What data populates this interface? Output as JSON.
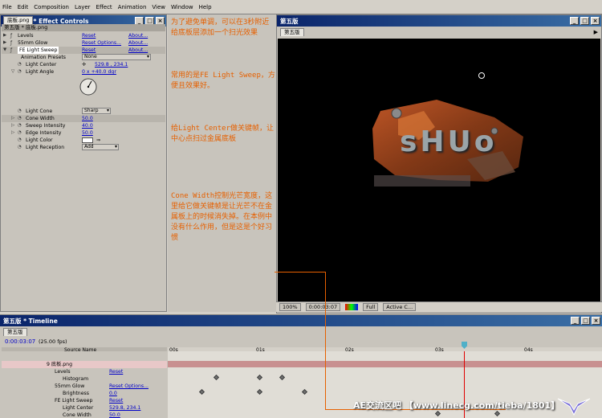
{
  "menu": [
    "File",
    "Edit",
    "Composition",
    "Layer",
    "Effect",
    "Animation",
    "View",
    "Window",
    "Help"
  ],
  "effect_controls": {
    "title": "底板.png * Effect Controls",
    "tab": "底板.png",
    "layer_path": "第五版 * 底板.png",
    "rows": [
      {
        "name": "Levels",
        "value": "Reset",
        "about": "About..."
      },
      {
        "name": "55mm Glow",
        "value": "Reset Options...",
        "about": "About..."
      },
      {
        "name": "FE Light Sweep",
        "value": "Reset",
        "about": "About..."
      },
      {
        "name": "Animation Presets",
        "value": "None"
      },
      {
        "name": "Light Center",
        "value": "529.8 , 234.1"
      },
      {
        "name": "Light Angle",
        "value": "0 x +40.0 dgr"
      },
      {
        "name": "Light Cone",
        "value": "Sharp"
      },
      {
        "name": "Cone Width",
        "value": "50.0"
      },
      {
        "name": "Sweep Intensity",
        "value": "40.0"
      },
      {
        "name": "Edge Intensity",
        "value": "50.0"
      },
      {
        "name": "Light Color",
        "value": ""
      },
      {
        "name": "Light Reception",
        "value": "Add"
      }
    ]
  },
  "notes": [
    "为了避免单调，可以在3秒附近给底板层添加一个扫光效果",
    "常用的是FE Light Sweep，方便且效果好。",
    "给Light Center做关键帧，让中心点扫过金属底板",
    "Cone Width控制光芒宽度，这里给它做关键帧是让光芒不在金属板上的时候消失掉。在本例中没有什么作用，但是这是个好习惯"
  ],
  "composition": {
    "title": "第五版",
    "tab": "第五版",
    "logo_text": "sHUo",
    "bottom": {
      "zoom": "100%",
      "time": "0:00:03:07",
      "quality": "Full",
      "camera": "Active C..."
    }
  },
  "timeline": {
    "title": "第五版 * Timeline",
    "tab": "第五版",
    "current_time": "0:00:03:07",
    "fps": "(25.00 fps)",
    "header_source": "Source Name",
    "ruler": [
      "00s",
      "01s",
      "02s",
      "03s",
      "04s"
    ],
    "rows": [
      {
        "indent": 1,
        "name": "9  底板.png",
        "value": ""
      },
      {
        "indent": 2,
        "name": "Levels",
        "value": "Reset"
      },
      {
        "indent": 3,
        "name": "Histogram",
        "value": ""
      },
      {
        "indent": 2,
        "name": "55mm Glow",
        "value": "Reset Options..."
      },
      {
        "indent": 3,
        "name": "Brightness",
        "value": "0.0"
      },
      {
        "indent": 2,
        "name": "FE Light Sweep",
        "value": "Reset"
      },
      {
        "indent": 3,
        "name": "Light Center",
        "value": "529.8, 234.1"
      },
      {
        "indent": 3,
        "name": "Cone Width",
        "value": "50.0"
      }
    ]
  },
  "watermark": "AE交流区吧 【www.linecg.com/tieba/1801】"
}
